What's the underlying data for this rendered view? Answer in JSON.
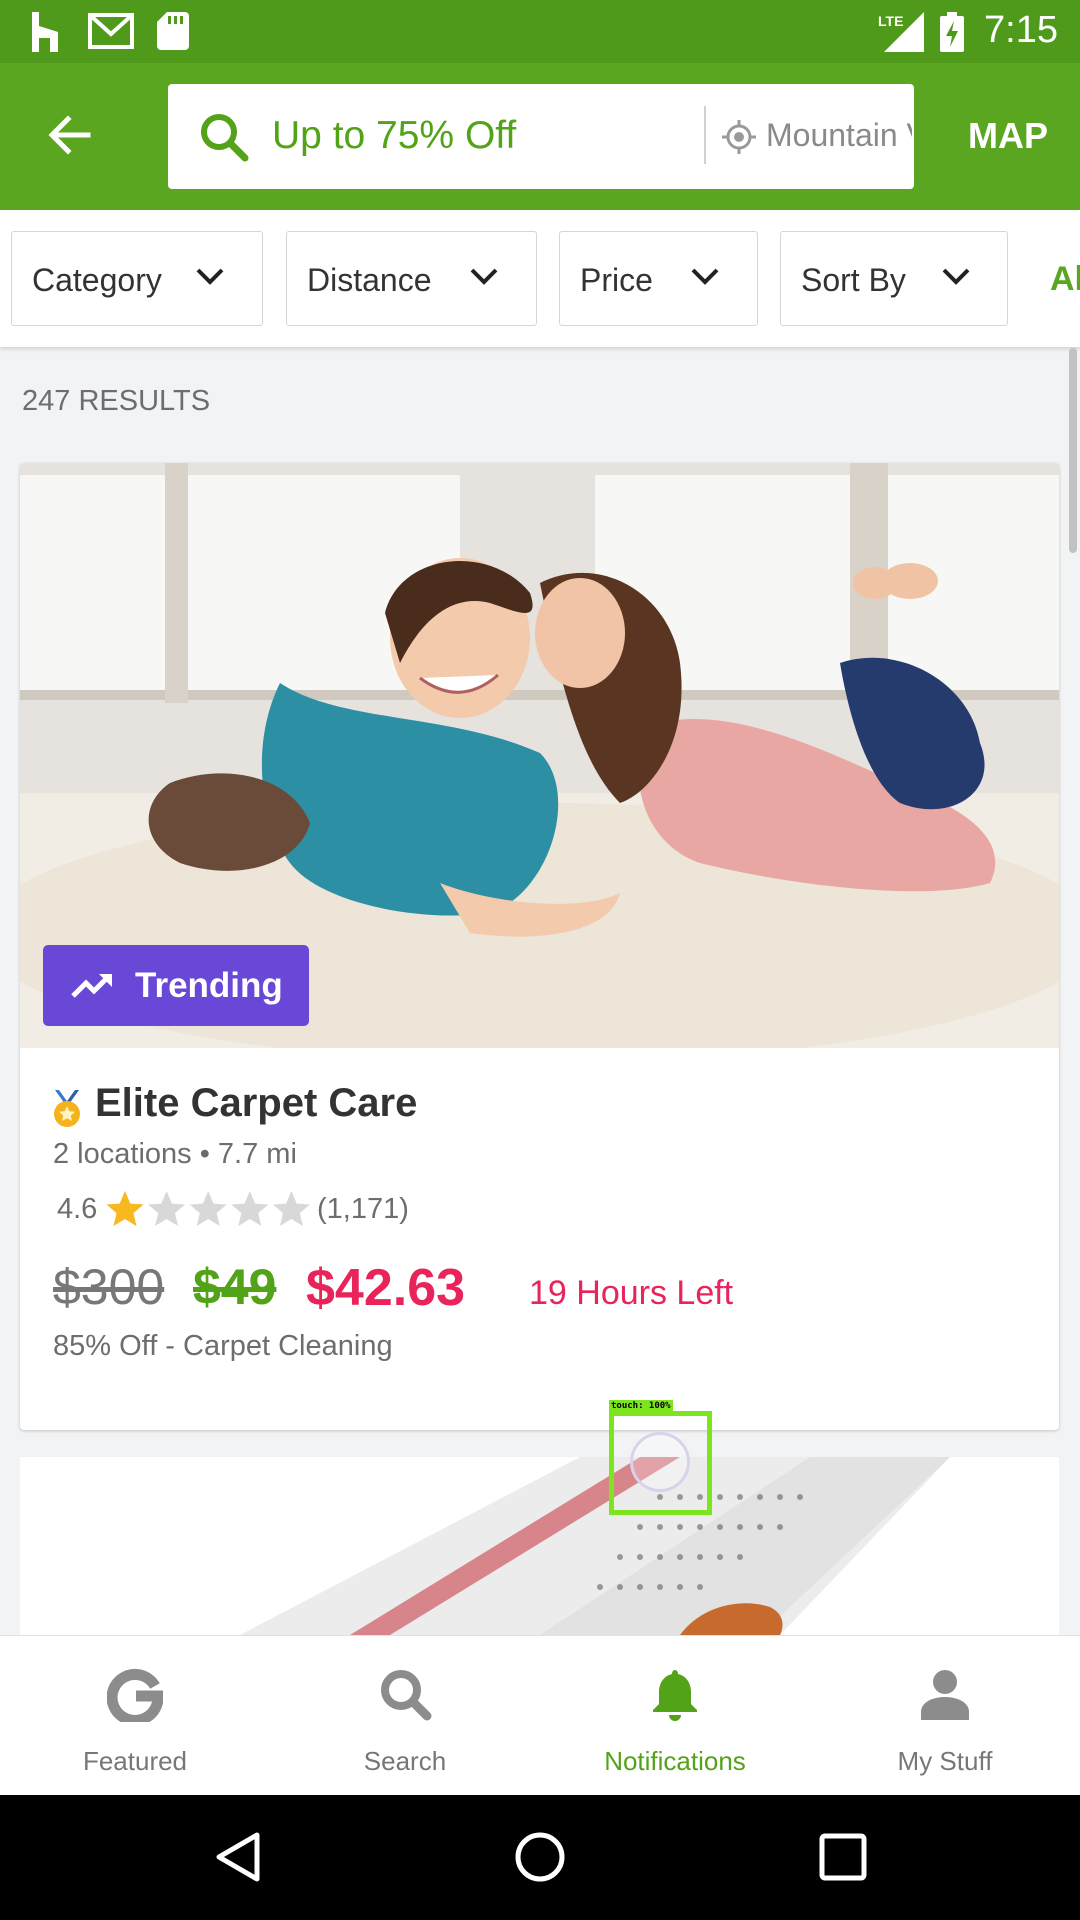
{
  "status_bar": {
    "time": "7:15",
    "icons": [
      "houzz-icon",
      "gmail-icon",
      "sd-card-icon",
      "lte-signal-icon",
      "battery-charging-icon"
    ],
    "network_label": "LTE"
  },
  "header": {
    "back_icon": "arrow-back-icon",
    "search_query": "Up to 75% Off",
    "location": "Mountain View",
    "map_label": "MAP",
    "accent_color": "#5ba621"
  },
  "filters": [
    {
      "label": "Category"
    },
    {
      "label": "Distance"
    },
    {
      "label": "Price"
    },
    {
      "label": "Sort By"
    },
    {
      "label": "All"
    }
  ],
  "results": {
    "count_text": "247 RESULTS"
  },
  "deal": {
    "badge_label": "Trending",
    "merchant": "Elite Carpet Care",
    "locations": "2 locations • 7.7 mi",
    "rating": "4.6",
    "rating_value": 4.6,
    "rating_count": "(1,171)",
    "original_price": "$300",
    "deal_price": "$49",
    "promo_price": "$42.63",
    "time_left": "19 Hours Left",
    "description": "85% Off - Carpet Cleaning",
    "badge_color": "#6a48d7",
    "promo_color": "#e8245a"
  },
  "touch_overlay": {
    "label": "touch: 100%"
  },
  "bottom_nav": {
    "items": [
      {
        "label": "Featured",
        "icon": "groupon-g-icon",
        "active": false
      },
      {
        "label": "Search",
        "icon": "search-icon",
        "active": false
      },
      {
        "label": "Notifications",
        "icon": "bell-icon",
        "active": true
      },
      {
        "label": "My Stuff",
        "icon": "person-icon",
        "active": false
      }
    ]
  },
  "system_nav": {
    "icons": [
      "back-triangle-icon",
      "home-circle-icon",
      "recents-square-icon"
    ]
  }
}
